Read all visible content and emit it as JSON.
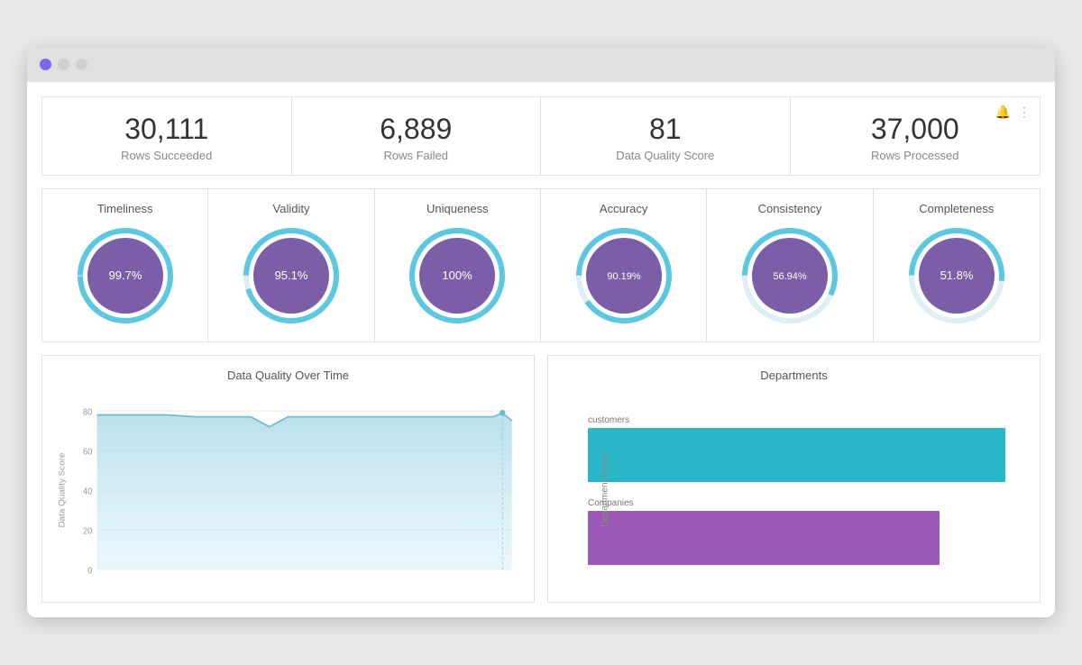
{
  "titlebar": {
    "dot1": "purple",
    "dot2": "gray",
    "dot3": "gray"
  },
  "metrics": [
    {
      "id": "rows-succeeded",
      "value": "30,111",
      "label": "Rows Succeeded"
    },
    {
      "id": "rows-failed",
      "value": "6,889",
      "label": "Rows Failed"
    },
    {
      "id": "data-quality-score",
      "value": "81",
      "label": "Data Quality Score"
    },
    {
      "id": "rows-processed",
      "value": "37,000",
      "label": "Rows Processed"
    }
  ],
  "gauges": [
    {
      "id": "timeliness",
      "title": "Timeliness",
      "value": 99.7,
      "display": "99.7%"
    },
    {
      "id": "validity",
      "title": "Validity",
      "value": 95.1,
      "display": "95.1%"
    },
    {
      "id": "uniqueness",
      "title": "Uniqueness",
      "value": 100,
      "display": "100%"
    },
    {
      "id": "accuracy",
      "title": "Accuracy",
      "value": 90.19,
      "display": "90.19%"
    },
    {
      "id": "consistency",
      "title": "Consistency",
      "value": 56.94,
      "display": "56.94%"
    },
    {
      "id": "completeness",
      "title": "Completeness",
      "value": 51.8,
      "display": "51.8%"
    }
  ],
  "line_chart": {
    "title": "Data Quality Over Time",
    "y_label": "Data Quality Score",
    "y_ticks": [
      20,
      40,
      60,
      80
    ],
    "data_approx": "mostly around 83, slight dip in middle, ends ~82"
  },
  "bar_chart": {
    "title": "Departments",
    "y_axis_label": "Department Name",
    "bars": [
      {
        "label": "customers",
        "width_pct": 95
      },
      {
        "label": "Companies",
        "width_pct": 80
      }
    ]
  }
}
